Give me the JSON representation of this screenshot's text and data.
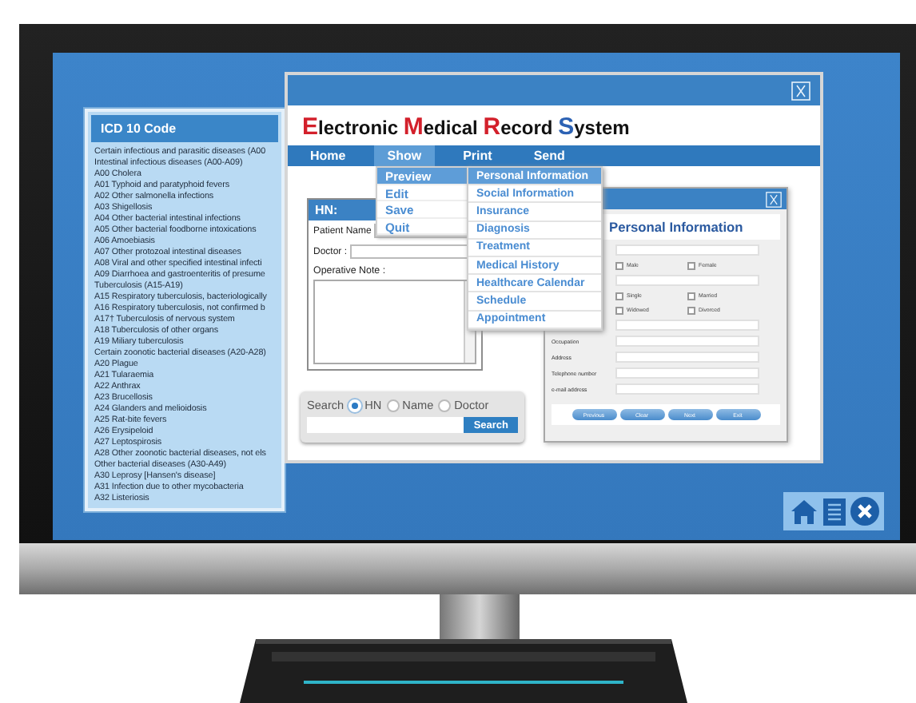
{
  "icd_panel": {
    "title": "ICD 10 Code",
    "items": [
      "Certain infectious and parasitic diseases (A00",
      "Intestinal infectious diseases (A00-A09)",
      "A00 Cholera",
      "A01 Typhoid and paratyphoid fevers",
      "A02 Other salmonella infections",
      "A03 Shigellosis",
      "A04 Other bacterial intestinal infections",
      "A05 Other bacterial foodborne intoxications",
      "A06 Amoebiasis",
      "A07 Other protozoal intestinal diseases",
      "A08 Viral and other specified intestinal infecti",
      "A09 Diarrhoea and gastroenteritis of presume",
      "Tuberculosis (A15-A19)",
      "A15 Respiratory tuberculosis, bacteriologically",
      "A16 Respiratory tuberculosis, not confirmed b",
      "A17† Tuberculosis of nervous system",
      "A18 Tuberculosis of other organs",
      "A19 Miliary tuberculosis",
      "Certain zoonotic bacterial diseases (A20-A28)",
      "A20 Plague",
      "A21 Tularaemia",
      "A22 Anthrax",
      "A23 Brucellosis",
      "A24 Glanders and melioidosis",
      "A25 Rat-bite fevers",
      "A26 Erysipeloid",
      "A27 Leptospirosis",
      "A28 Other zoonotic bacterial diseases, not els",
      "Other bacterial diseases (A30-A49)",
      "A30 Leprosy [Hansen's disease]",
      "A31 Infection due to other mycobacteria",
      "A32 Listeriosis"
    ]
  },
  "emr_window": {
    "title": "Electronic Medical Record System",
    "menu": [
      {
        "label": "Home",
        "selected": false
      },
      {
        "label": "Show",
        "selected": true,
        "submenu": [
          {
            "label": "Preview",
            "selected": true
          },
          {
            "label": "Edit",
            "selected": false
          },
          {
            "label": "Save",
            "selected": false
          },
          {
            "label": "Quit",
            "selected": false
          }
        ]
      },
      {
        "label": "Print",
        "selected": false
      },
      {
        "label": "Send",
        "selected": false
      }
    ],
    "preview_submenu": [
      {
        "label": "Personal Information",
        "selected": true
      },
      {
        "label": "Social Information",
        "selected": false
      },
      {
        "label": "Insurance",
        "selected": false
      },
      {
        "label": "Diagnosis",
        "selected": false
      },
      {
        "label": "Treatment",
        "selected": false
      },
      {
        "label": "Medical History",
        "selected": false
      },
      {
        "label": "Healthcare Calendar",
        "selected": false
      },
      {
        "label": "Schedule",
        "selected": false
      },
      {
        "label": "Appointment",
        "selected": false
      }
    ],
    "hn_panel": {
      "title": "HN:",
      "fields": [
        {
          "label": "Patient Name",
          "kind": "line"
        },
        {
          "label": "Doctor :",
          "kind": "line"
        },
        {
          "label": "Operative Note :",
          "kind": "area"
        }
      ]
    },
    "search_panel": {
      "label": "Search",
      "options": [
        {
          "label": "HN",
          "selected": true
        },
        {
          "label": "Name",
          "selected": false
        },
        {
          "label": "Doctor",
          "selected": false
        }
      ],
      "button": "Search"
    },
    "personal_window": {
      "title": "Personal Information",
      "rows": [
        {
          "kind": "field"
        },
        {
          "kind": "checks",
          "options": [
            {
              "label": "Male",
              "checked": false
            },
            {
              "label": "Female",
              "checked": false
            }
          ]
        },
        {
          "kind": "field"
        },
        {
          "kind": "checks",
          "options": [
            {
              "label": "Single",
              "checked": false
            },
            {
              "label": "Married",
              "checked": false
            }
          ]
        },
        {
          "kind": "checks",
          "options": [
            {
              "label": "Widowed",
              "checked": false
            },
            {
              "label": "Divorced",
              "checked": false
            }
          ]
        },
        {
          "kind": "field"
        },
        {
          "kind": "field",
          "label": "Occupation"
        },
        {
          "kind": "field",
          "label": "Address"
        },
        {
          "kind": "field",
          "label": "Telephone number"
        },
        {
          "kind": "field",
          "label": "e-mail address"
        }
      ],
      "buttons": [
        "Previous",
        "Clear",
        "Next",
        "Exit"
      ]
    }
  }
}
